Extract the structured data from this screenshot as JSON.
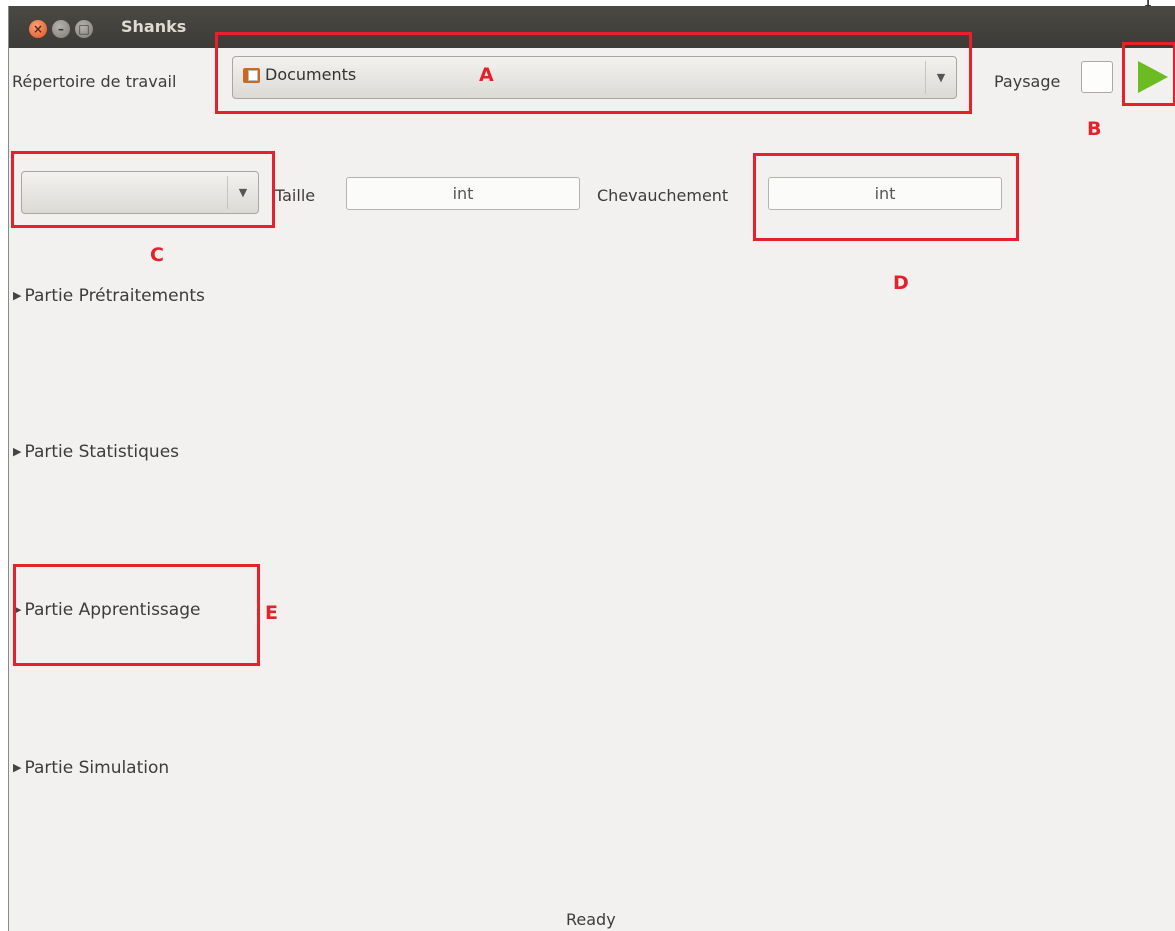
{
  "page_glyph": "1",
  "window": {
    "title": "Shanks",
    "close_glyph": "×",
    "min_glyph": "–",
    "max_glyph": "□"
  },
  "toolbar": {
    "workdir_label": "Répertoire de travail",
    "workdir_value": "Documents",
    "landscape_label": "Paysage"
  },
  "params": {
    "size_label": "Taille",
    "size_placeholder": "int",
    "overlap_label": "Chevauchement",
    "overlap_placeholder": "int",
    "mode_value": ""
  },
  "sections": [
    {
      "label": "Partie Prétraitements"
    },
    {
      "label": "Partie Statistiques"
    },
    {
      "label": "Partie Apprentissage"
    },
    {
      "label": "Partie  Simulation"
    }
  ],
  "status": "Ready",
  "annotations": {
    "a": "A",
    "b": "B",
    "c": "C",
    "d": "D",
    "e": "E",
    "color": "#e5222b"
  },
  "icons": [
    "folder-icon",
    "play-icon",
    "chevron-down-icon",
    "expander-icon"
  ]
}
